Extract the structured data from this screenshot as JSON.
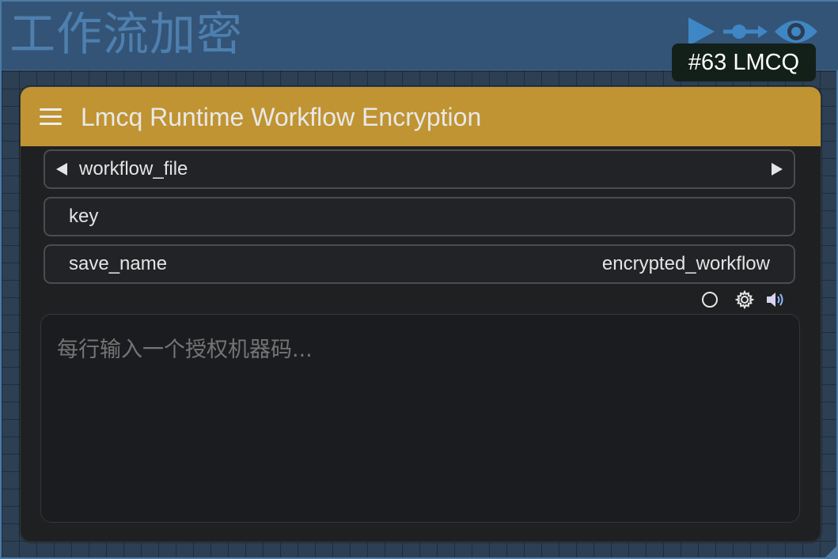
{
  "group": {
    "title": "工作流加密",
    "toolbar": {
      "play_icon": "play-icon",
      "link_icon": "node-link-icon",
      "eye_icon": "eye-icon"
    }
  },
  "badge": {
    "text": "#63 LMCQ"
  },
  "node": {
    "title": "Lmcq Runtime Workflow Encryption",
    "menu_icon": "hamburger-menu-icon",
    "widgets": {
      "workflow_file": {
        "label": "workflow_file",
        "value": ""
      },
      "key": {
        "label": "key",
        "value": ""
      },
      "save_name": {
        "label": "save_name",
        "value": "encrypted_workflow"
      }
    },
    "status_icons": [
      "circle-icon",
      "gear-icon",
      "speaker-icon"
    ],
    "textarea": {
      "placeholder": "每行输入一个授权机器码...",
      "value": ""
    }
  },
  "colors": {
    "group_header": "#335476",
    "group_title": "#4e7fae",
    "node_header": "#c09432",
    "node_body": "#1e2022",
    "badge_bg": "#13201a",
    "toolbar_icon": "#3f86c4"
  }
}
